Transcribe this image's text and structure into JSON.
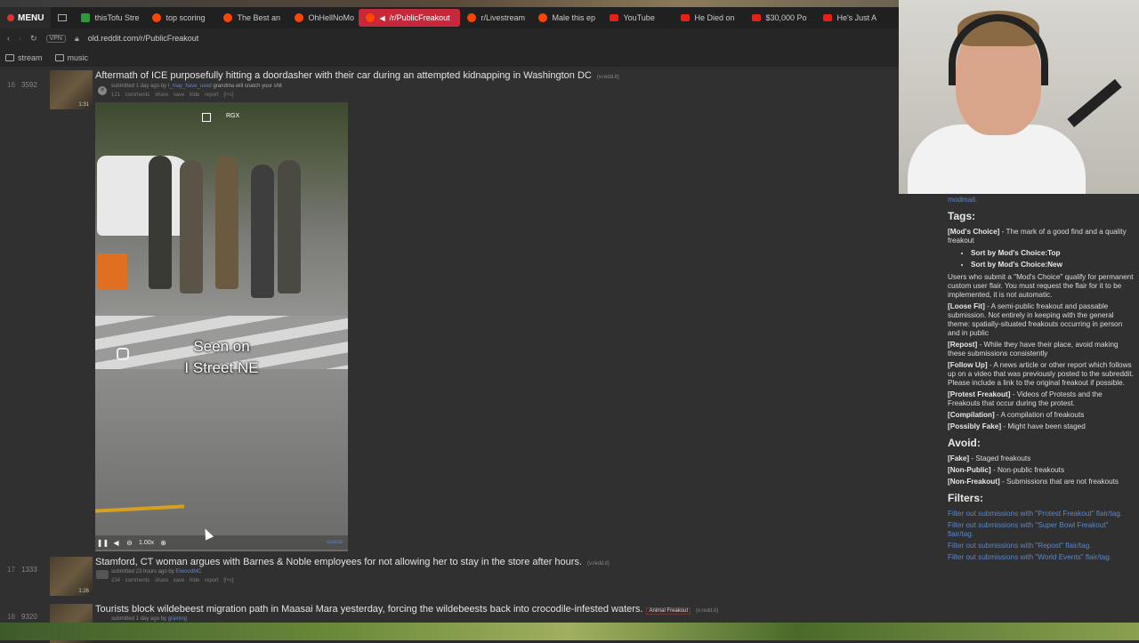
{
  "browser": {
    "menu_label": "MENU",
    "tabs": [
      {
        "label": "thisTofu Stre",
        "icon": "green-icon"
      },
      {
        "label": "top scoring",
        "icon": "reddit-icon"
      },
      {
        "label": "The Best an",
        "icon": "reddit-icon"
      },
      {
        "label": "OhHellNoMo",
        "icon": "reddit-icon"
      },
      {
        "label": "/r/PublicFreakout",
        "icon": "reddit-icon",
        "active": true
      },
      {
        "label": "r/Livestream",
        "icon": "reddit-icon"
      },
      {
        "label": "Male this ep",
        "icon": "reddit-icon"
      },
      {
        "label": "YouTube",
        "icon": "youtube-icon"
      },
      {
        "label": "He Died on",
        "icon": "youtube-icon"
      },
      {
        "label": "$30,000 Po",
        "icon": "youtube-icon"
      },
      {
        "label": "He's Just A",
        "icon": "youtube-icon"
      }
    ],
    "vpn_label": "VPN",
    "url": "old.reddit.com/r/PublicFreakout",
    "bookmarks": [
      "stream",
      "music"
    ]
  },
  "posts": [
    {
      "rank": "16",
      "votes": "3592",
      "duration": "1:31",
      "title": "Aftermath of ICE purposefully hitting a doordasher with their car during an attempted kidnapping in Washington DC",
      "domain": "(v.redd.it)",
      "submitted": "submitted 1 day ago by",
      "user": "I_may_have_used",
      "user_flair": "grandma will snatch your shit",
      "actions": "121 comments share save hide report [l+c]"
    },
    {
      "rank": "17",
      "votes": "1333",
      "duration": "1:26",
      "title": "Stamford, CT woman argues with Barnes & Noble employees for not allowing her to stay in the store after hours.",
      "domain": "(v.redd.it)",
      "submitted": "submitted 23 hours ago by",
      "user": "ElwoodMC",
      "actions": "234 comments share save hide report [l+c]"
    },
    {
      "rank": "18",
      "votes": "9320",
      "title": "Tourists block wildebeest migration path in Maasai Mara yesterday, forcing the wildebeests back into crocodile-infested waters.",
      "flair": "Animal Freakout",
      "domain": "(v.redd.it)",
      "submitted": "submitted 1 day ago by",
      "user": "graining"
    }
  ],
  "video": {
    "overlay_label": "RGX",
    "caption_line1": "Seen on",
    "caption_line2": "I Street NE",
    "speed": "1.00x",
    "source_label": "source"
  },
  "sidebar": {
    "modmail": "modmail.",
    "tags_heading": "Tags:",
    "tags": [
      {
        "tag": "[Mod's Choice]",
        "desc": " - The mark of a good find and a quality freakout"
      },
      {
        "tag": "[Loose Fit]",
        "desc": " - A semi-public freakout and passable submission. Not entirely in keeping with the general theme: spatially-situated freakouts occurring in person and in public"
      },
      {
        "tag": "[Repost]",
        "desc": " - While they have their place, avoid making these submissions consistently"
      },
      {
        "tag": "[Follow Up]",
        "desc": " - A news article or other report which follows up on a video that was previously posted to the subreddit. Please include a link to the original freakout if possible."
      },
      {
        "tag": "[Protest Freakout]",
        "desc": " - Videos of Protests and the Freakouts that occur during the protest."
      },
      {
        "tag": "[Compilation]",
        "desc": " - A compilation of freakouts"
      },
      {
        "tag": "[Possibly Fake]",
        "desc": " - Might have been staged"
      }
    ],
    "sort_top": "Sort by Mod's Choice:Top",
    "sort_new": "Sort by Mod's Choice:New",
    "mods_choice_note": "Users who submit a \"Mod's Choice\" qualify for permanent custom user flair. You must request the flair for it to be implemented, it is not automatic.",
    "avoid_heading": "Avoid:",
    "avoid": [
      {
        "tag": "[Fake]",
        "desc": " - Staged freakouts"
      },
      {
        "tag": "[Non-Public]",
        "desc": " - Non-public freakouts"
      },
      {
        "tag": "[Non-Freakout]",
        "desc": " - Submissions that are not freakouts"
      }
    ],
    "filters_heading": "Filters:",
    "filters": [
      "Filter out submissions with \"Protest Freakout\" flair/tag.",
      "Filter out submissions with \"Super Bowl Freakout\" flair/tag.",
      "Filter out submissions with \"Repost\" flair/tag.",
      "Filter out submissions with \"World Events\" flair/tag."
    ]
  }
}
